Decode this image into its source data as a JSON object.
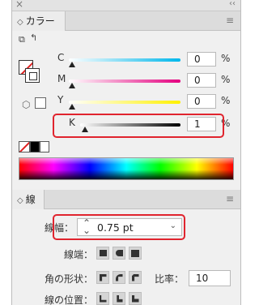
{
  "panel": {
    "close_glyph": "×",
    "collapse_glyph": "‹‹",
    "menu_glyph": "≡"
  },
  "color_panel": {
    "tab_label": "カラー",
    "rows": [
      {
        "label": "C",
        "value": "0",
        "unit": "%"
      },
      {
        "label": "M",
        "value": "0",
        "unit": "%"
      },
      {
        "label": "Y",
        "value": "0",
        "unit": "%"
      },
      {
        "label": "K",
        "value": "1",
        "unit": "%"
      }
    ]
  },
  "stroke_panel": {
    "tab_label": "線",
    "weight_label": "線幅：",
    "weight_value": "0.75 pt",
    "cap_label": "線端：",
    "corner_label": "角の形状：",
    "ratio_label": "比率：",
    "ratio_value": "10",
    "align_label": "線の位置："
  },
  "colors": {
    "highlight": "#e0242e",
    "panel_bg": "#f0f0f0",
    "cyan_slider": "#00b7eb",
    "magenta_slider": "#e4007f",
    "yellow_slider": "#fff100",
    "black_slider": "#000000"
  },
  "icons": [
    "close-icon",
    "collapse-panel-icon",
    "panel-menu-icon",
    "default-fill-stroke-icon",
    "swap-fill-stroke-icon",
    "fill-stroke-selector-icon",
    "out-of-gamut-cube-icon",
    "none-swatch-icon",
    "black-swatch-icon",
    "white-swatch-icon",
    "butt-cap-icon",
    "round-cap-icon",
    "projecting-cap-icon",
    "miter-join-icon",
    "round-join-icon",
    "bevel-join-icon",
    "align-center-icon",
    "align-inside-icon",
    "align-outside-icon"
  ]
}
